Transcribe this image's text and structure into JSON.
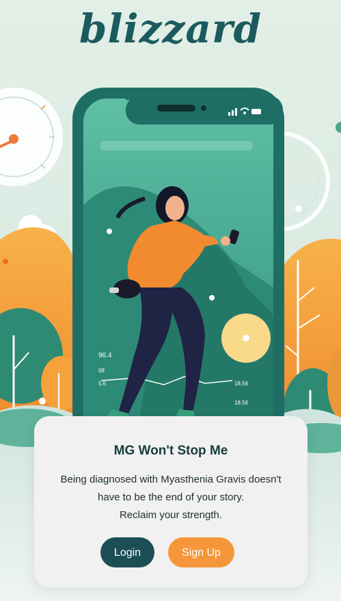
{
  "app": {
    "logo_text": "blizzard"
  },
  "phone": {
    "status_icons": [
      "signal-icon",
      "wifi-icon",
      "battery-icon"
    ],
    "stats": [
      "96.4",
      "08",
      "5.6",
      "18.56",
      "18.56"
    ]
  },
  "card": {
    "title": "MG Won't Stop Me",
    "line1": "Being diagnosed with Myasthenia Gravis doesn't",
    "line2": "have to be the end of your story.",
    "line3": "Reclaim your strength.",
    "login_label": "Login",
    "signup_label": "Sign Up"
  },
  "colors": {
    "brand": "#1b5b5e",
    "login": "#1b4f55",
    "signup": "#f5963a",
    "background": "#dcebe2"
  }
}
